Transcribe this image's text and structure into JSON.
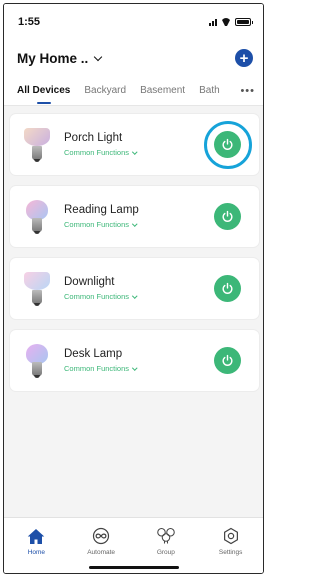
{
  "status_bar": {
    "time": "1:55"
  },
  "header": {
    "home_title": "My Home ..",
    "add_icon": "plus-circle-icon"
  },
  "tabs": [
    {
      "label": "All Devices",
      "active": true
    },
    {
      "label": "Backyard",
      "active": false
    },
    {
      "label": "Basement",
      "active": false
    },
    {
      "label": "Bath",
      "active": false
    }
  ],
  "tabs_more": "•••",
  "devices": [
    {
      "name": "Porch Light",
      "sub_label": "Common Functions",
      "bulb_type": "flood",
      "glass_color": "#e6c8b8",
      "power_on": true
    },
    {
      "name": "Reading Lamp",
      "sub_label": "Common Functions",
      "bulb_type": "standard",
      "glass_color": "#c9a3e8",
      "power_on": true
    },
    {
      "name": "Downlight",
      "sub_label": "Common Functions",
      "bulb_type": "flood",
      "glass_color": "#f0c8e6",
      "power_on": true
    },
    {
      "name": "Desk Lamp",
      "sub_label": "Common Functions",
      "bulb_type": "standard",
      "glass_color": "#d7a9ef",
      "power_on": true
    }
  ],
  "bottom_nav": [
    {
      "label": "Home",
      "icon": "home-icon",
      "active": true
    },
    {
      "label": "Automate",
      "icon": "automate-icon",
      "active": false
    },
    {
      "label": "Group",
      "icon": "group-icon",
      "active": false
    },
    {
      "label": "Settings",
      "icon": "settings-icon",
      "active": false
    }
  ],
  "colors": {
    "accent": "#1d4fa8",
    "power_green": "#3cb778",
    "highlight": "#16a3d9"
  }
}
